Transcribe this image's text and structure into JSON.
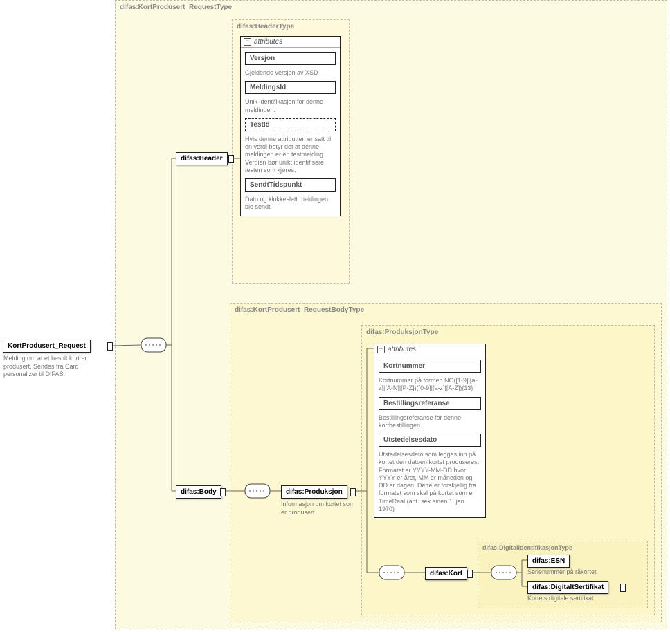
{
  "root": {
    "name": "KortProdusert_Request",
    "desc": "Melding om at et bestilt kort er produsert. Sendes fra Card personalizer til DIFAS."
  },
  "requestType": {
    "label": "difas:KortProdusert_RequestType"
  },
  "header": {
    "element": "difas:Header",
    "typeLabel": "difas:HeaderType",
    "attrTitle": "attributes",
    "versjon": {
      "name": "Versjon",
      "desc": "Gjeldende versjon av XSD"
    },
    "meldingsId": {
      "name": "MeldingsId",
      "desc": "Unik identifikasjon for denne meldingen."
    },
    "testId": {
      "name": "TestId",
      "desc": "Hvis denne attributten er satt til en verdi betyr det at denne meldingen er en testmelding. Verdien bør unikt identifisere testen som kjøres."
    },
    "sendtTidspunkt": {
      "name": "SendtTidspunkt",
      "desc": "Dato og klokkeslett meldingen ble sendt."
    }
  },
  "body": {
    "element": "difas:Body",
    "typeLabel": "difas:KortProdusert_RequestBodyType"
  },
  "produksjon": {
    "element": "difas:Produksjon",
    "desc": "Informasjon om kortet som er produsert",
    "typeLabel": "difas:ProduksjonType",
    "attrTitle": "attributes",
    "kortnummer": {
      "name": "Kortnummer",
      "desc": "Kortnummer på formen NO([1-9]|[a-z]|[A-N]|[P-Z])([0-9]|[a-z]|[A-Z]){13}"
    },
    "bestillingsreferanse": {
      "name": "Bestillingsreferanse",
      "desc": "Bestillingsreferanse for denne kortbestillingen."
    },
    "utstedelsesdato": {
      "name": "Utstedelsesdato",
      "desc": "Utstedelsesdato som legges inn på kortet den datoen kortet produseres. Formatet er YYYY-MM-DD hvor YYYY er året, MM er måneden og DD er dagen. Dette er forskjellig fra formatet som skal på kortet som er TimeReal (ant. sek siden 1. jan 1970)"
    }
  },
  "kort": {
    "element": "difas:Kort",
    "typeLabel": "difas:DigitalIdentifikasjonType",
    "esn": {
      "name": "difas:ESN",
      "desc": "Serienummer på råkortet"
    },
    "sert": {
      "name": "difas:DigitaltSertifikat",
      "desc": "Kortets digitale sertifikat"
    }
  }
}
